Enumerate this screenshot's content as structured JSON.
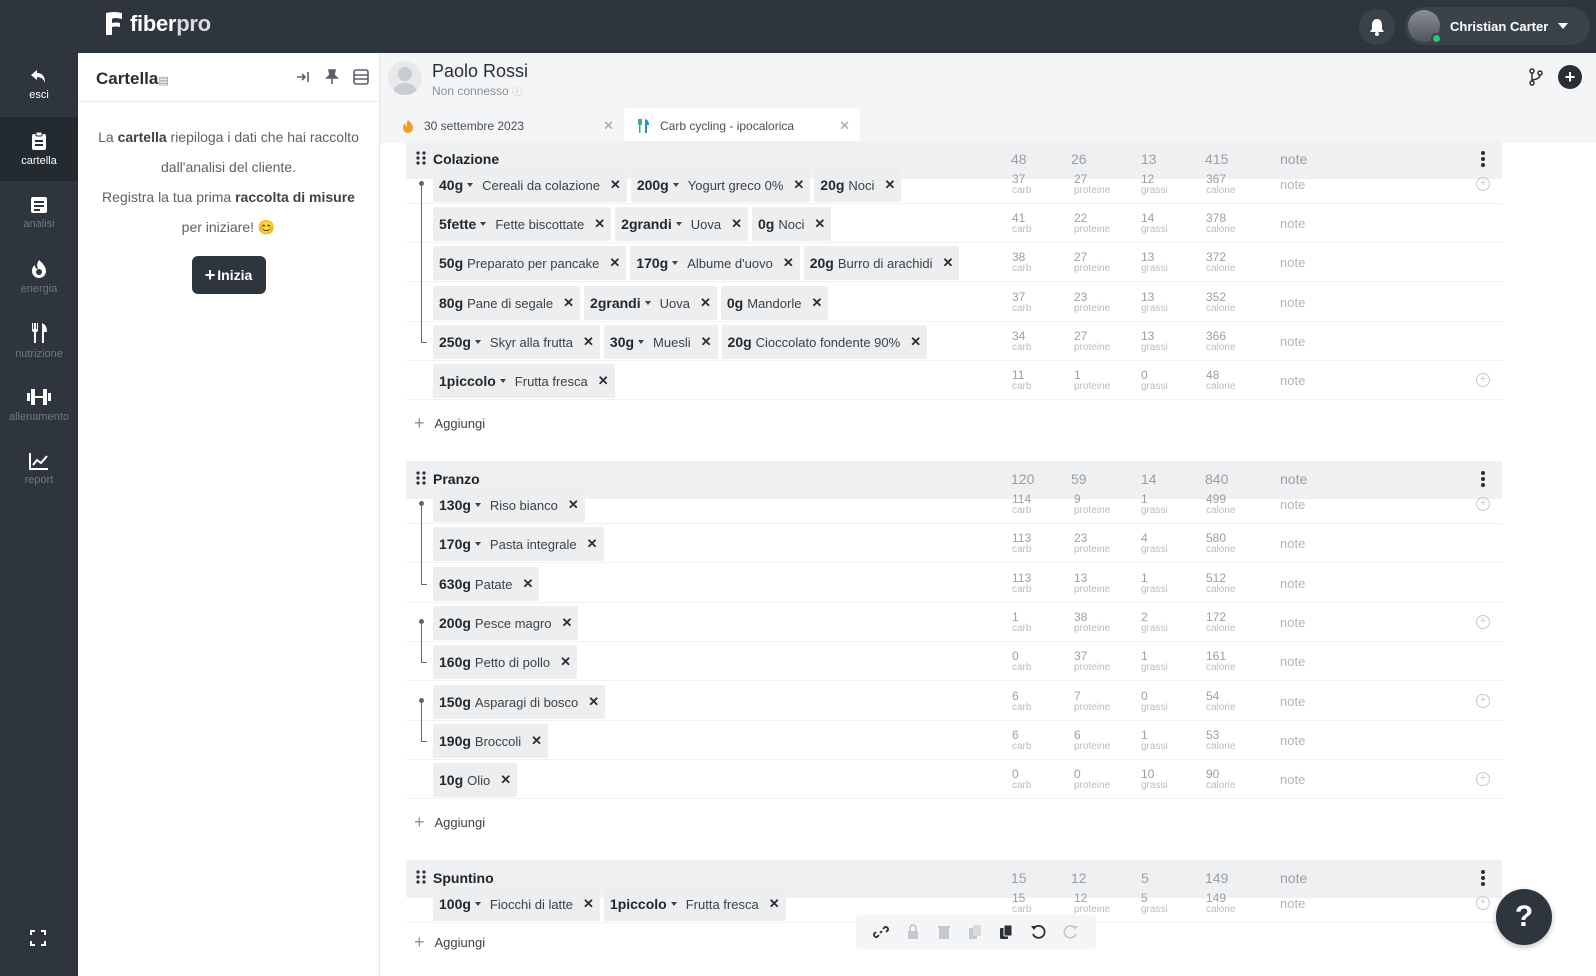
{
  "app": {
    "logo_fiber": "fiber",
    "logo_pro": "pro"
  },
  "user": {
    "name": "Christian Carter"
  },
  "nav": [
    {
      "label": "esci",
      "icon": "back-arrow-icon"
    },
    {
      "label": "cartella",
      "icon": "clipboard-icon"
    },
    {
      "label": "analisi",
      "icon": "document-icon"
    },
    {
      "label": "energia",
      "icon": "flame-icon"
    },
    {
      "label": "nutrizione",
      "icon": "fork-knife-icon"
    },
    {
      "label": "allenamento",
      "icon": "dumbbell-icon"
    },
    {
      "label": "report",
      "icon": "chart-icon"
    }
  ],
  "cartella": {
    "title": "Cartella",
    "t1": "La ",
    "t1b": "cartella",
    "t2": " riepiloga i dati che hai raccolto dall'analisi del cliente.",
    "t3": "Registra la tua prima ",
    "t3b": "raccolta di misure",
    "t4": " per iniziare! 😊",
    "button": "Inizia"
  },
  "client": {
    "name": "Paolo Rossi",
    "status": "Non connesso"
  },
  "tabs": [
    {
      "label": "30 settembre 2023"
    },
    {
      "label": "Carb cycling - ipocalorica"
    }
  ],
  "labels": {
    "carb": "carb",
    "proteine": "proteine",
    "grassi": "grassi",
    "calorie": "calorie",
    "note": "note",
    "add": "Aggiungi"
  },
  "meals": [
    {
      "name": "Colazione",
      "totals": [
        "48",
        "26",
        "13",
        "415"
      ],
      "rows": [
        {
          "chips": [
            {
              "qty": "40g",
              "caret": true,
              "name": "Cereali da colazione"
            },
            {
              "qty": "200g",
              "caret": true,
              "name": "Yogurt greco 0%"
            },
            {
              "qty": "20g",
              "caret": false,
              "name": "Noci"
            }
          ],
          "m": [
            "37",
            "27",
            "12",
            "367"
          ]
        },
        {
          "chips": [
            {
              "qty": "5fette",
              "caret": true,
              "name": "Fette biscottate"
            },
            {
              "qty": "2grandi",
              "caret": true,
              "name": "Uova"
            },
            {
              "qty": "0g",
              "caret": false,
              "name": "Noci"
            }
          ],
          "m": [
            "41",
            "22",
            "14",
            "378"
          ]
        },
        {
          "chips": [
            {
              "qty": "50g",
              "caret": false,
              "name": "Preparato per pancake"
            },
            {
              "qty": "170g",
              "caret": true,
              "name": "Albume d'uovo"
            },
            {
              "qty": "20g",
              "caret": false,
              "name": "Burro di arachidi"
            }
          ],
          "m": [
            "38",
            "27",
            "13",
            "372"
          ]
        },
        {
          "chips": [
            {
              "qty": "80g",
              "caret": false,
              "name": "Pane di segale"
            },
            {
              "qty": "2grandi",
              "caret": true,
              "name": "Uova"
            },
            {
              "qty": "0g",
              "caret": false,
              "name": "Mandorle"
            }
          ],
          "m": [
            "37",
            "23",
            "13",
            "352"
          ]
        },
        {
          "chips": [
            {
              "qty": "250g",
              "caret": true,
              "name": "Skyr alla frutta"
            },
            {
              "qty": "30g",
              "caret": true,
              "name": "Muesli"
            },
            {
              "qty": "20g",
              "caret": false,
              "name": "Cioccolato fondente 90%"
            }
          ],
          "m": [
            "34",
            "27",
            "13",
            "366"
          ]
        },
        {
          "chips": [
            {
              "qty": "1piccolo",
              "caret": true,
              "name": "Frutta fresca"
            }
          ],
          "m": [
            "11",
            "1",
            "0",
            "48"
          ]
        }
      ]
    },
    {
      "name": "Pranzo",
      "totals": [
        "120",
        "59",
        "14",
        "840"
      ],
      "rows": [
        {
          "chips": [
            {
              "qty": "130g",
              "caret": true,
              "name": "Riso bianco"
            }
          ],
          "m": [
            "114",
            "9",
            "1",
            "499"
          ]
        },
        {
          "chips": [
            {
              "qty": "170g",
              "caret": true,
              "name": "Pasta integrale"
            }
          ],
          "m": [
            "113",
            "23",
            "4",
            "580"
          ]
        },
        {
          "chips": [
            {
              "qty": "630g",
              "caret": false,
              "name": "Patate"
            }
          ],
          "m": [
            "113",
            "13",
            "1",
            "512"
          ]
        },
        {
          "chips": [
            {
              "qty": "200g",
              "caret": false,
              "name": "Pesce magro"
            }
          ],
          "m": [
            "1",
            "38",
            "2",
            "172"
          ]
        },
        {
          "chips": [
            {
              "qty": "160g",
              "caret": false,
              "name": "Petto di pollo"
            }
          ],
          "m": [
            "0",
            "37",
            "1",
            "161"
          ]
        },
        {
          "chips": [
            {
              "qty": "150g",
              "caret": false,
              "name": "Asparagi di bosco"
            }
          ],
          "m": [
            "6",
            "7",
            "0",
            "54"
          ]
        },
        {
          "chips": [
            {
              "qty": "190g",
              "caret": false,
              "name": "Broccoli"
            }
          ],
          "m": [
            "6",
            "6",
            "1",
            "53"
          ]
        },
        {
          "chips": [
            {
              "qty": "10g",
              "caret": false,
              "name": "Olio"
            }
          ],
          "m": [
            "0",
            "0",
            "10",
            "90"
          ]
        }
      ]
    },
    {
      "name": "Spuntino",
      "totals": [
        "15",
        "12",
        "5",
        "149"
      ],
      "rows": [
        {
          "chips": [
            {
              "qty": "100g",
              "caret": true,
              "name": "Fiocchi di latte"
            },
            {
              "qty": "1piccolo",
              "caret": true,
              "name": "Frutta fresca"
            }
          ],
          "m": [
            "15",
            "12",
            "5",
            "149"
          ]
        }
      ]
    }
  ]
}
